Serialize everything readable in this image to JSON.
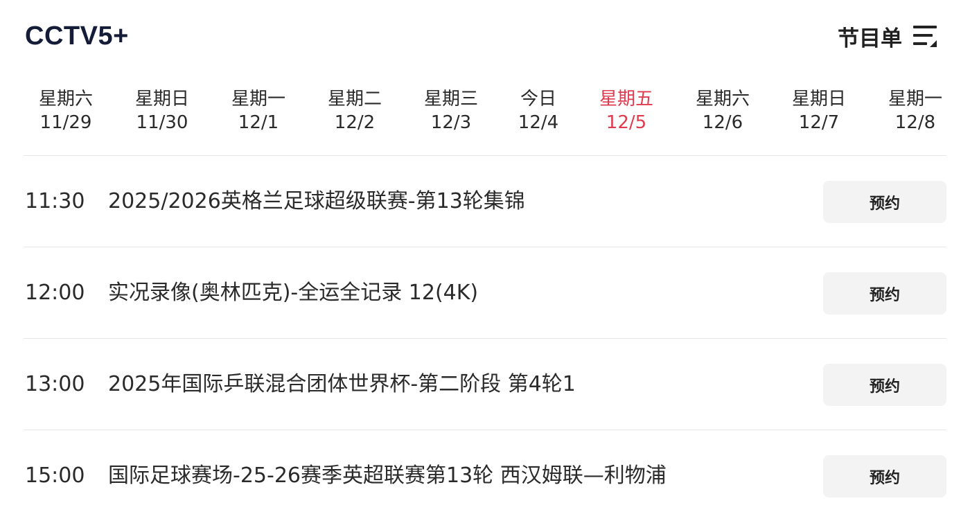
{
  "header": {
    "channel_title": "CCTV5+",
    "schedule_label": "节目单",
    "schedule_icon": "menu-lines-icon"
  },
  "dates": [
    {
      "dow": "星期六",
      "md": "11/29"
    },
    {
      "dow": "星期日",
      "md": "11/30"
    },
    {
      "dow": "星期一",
      "md": "12/1"
    },
    {
      "dow": "星期二",
      "md": "12/2"
    },
    {
      "dow": "星期三",
      "md": "12/3"
    },
    {
      "dow": "今日",
      "md": "12/4"
    },
    {
      "dow": "星期五",
      "md": "12/5"
    },
    {
      "dow": "星期六",
      "md": "12/6"
    },
    {
      "dow": "星期日",
      "md": "12/7"
    },
    {
      "dow": "星期一",
      "md": "12/8"
    }
  ],
  "selected_date_index": 6,
  "colors": {
    "accent": "#e03a4e",
    "title": "#141c38",
    "button_bg": "#f3f3f3"
  },
  "programs": [
    {
      "time": "11:30",
      "title": "2025/2026英格兰足球超级联赛-第13轮集锦",
      "button": "预约"
    },
    {
      "time": "12:00",
      "title": "实况录像(奥林匹克)-全运全记录 12(4K)",
      "button": "预约"
    },
    {
      "time": "13:00",
      "title": "2025年国际乒联混合团体世界杯-第二阶段 第4轮1",
      "button": "预约"
    },
    {
      "time": "15:00",
      "title": "国际足球赛场-25-26赛季英超联赛第13轮 西汉姆联—利物浦",
      "button": "预约"
    }
  ]
}
